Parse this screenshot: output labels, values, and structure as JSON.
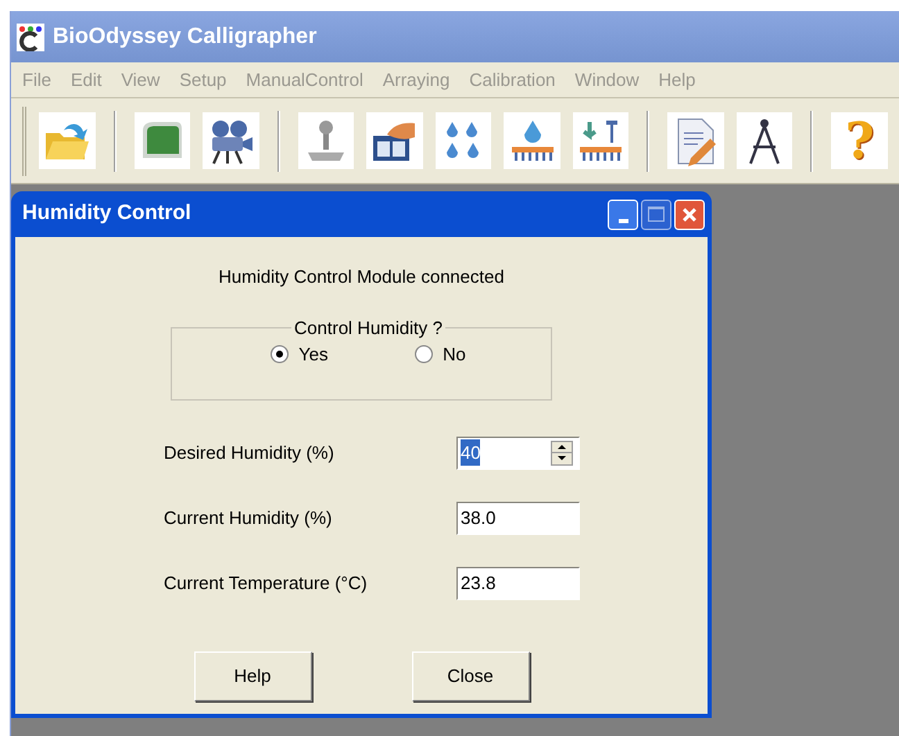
{
  "app": {
    "title": "BioOdyssey Calligrapher"
  },
  "menu": [
    "File",
    "Edit",
    "View",
    "Setup",
    "ManualControl",
    "Arraying",
    "Calibration",
    "Window",
    "Help"
  ],
  "toolbar": {
    "help_glyph": "?"
  },
  "dialog": {
    "title": "Humidity Control",
    "status": "Humidity Control Module connected",
    "group": {
      "legend": "Control Humidity ?",
      "options": [
        {
          "label": "Yes",
          "selected": true
        },
        {
          "label": "No",
          "selected": false
        }
      ]
    },
    "fields": [
      {
        "kind": "spinner",
        "label": "Desired Humidity (%)",
        "value": "40",
        "value_selected": true
      },
      {
        "kind": "text",
        "label": "Current Humidity (%)",
        "value": "38.0",
        "value_selected": false
      },
      {
        "kind": "text",
        "label": "Current Temperature (°C)",
        "value": "23.8",
        "value_selected": false
      }
    ],
    "buttons": [
      "Help",
      "Close"
    ]
  }
}
